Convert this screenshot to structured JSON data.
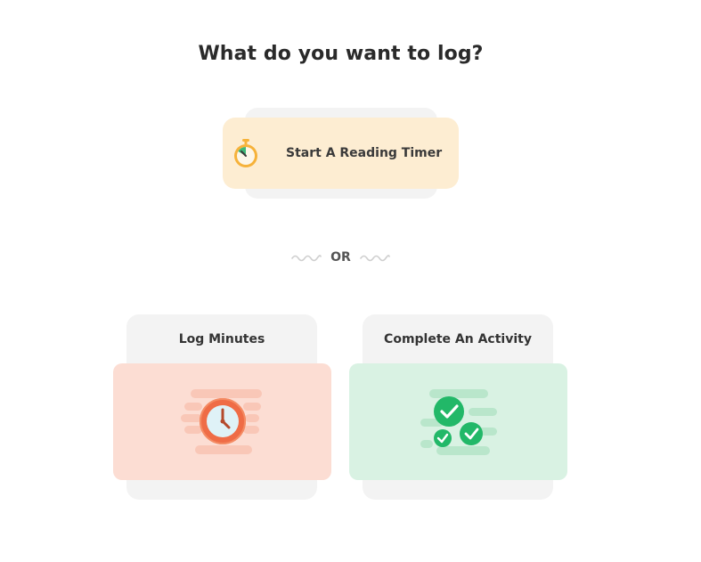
{
  "title": "What do you want to log?",
  "reading_timer": {
    "label": "Start A Reading Timer",
    "icon": "stopwatch-icon"
  },
  "divider": {
    "text": "OR"
  },
  "options": [
    {
      "label": "Log Minutes",
      "icon": "clock-icon"
    },
    {
      "label": "Complete An Activity",
      "icon": "checkmarks-icon"
    }
  ],
  "colors": {
    "timer_card": "#fdedd2",
    "log_minutes_card": "#fcddd3",
    "activity_card": "#d9f2e3",
    "card_back": "#f3f3f3",
    "clock_accent": "#ef6c46",
    "check_green": "#22b868"
  }
}
